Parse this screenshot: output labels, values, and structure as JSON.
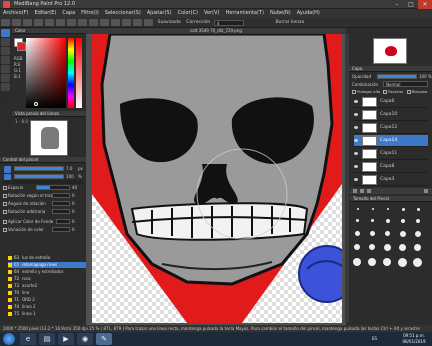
{
  "window": {
    "title": "MediBang Paint Pro 12.0",
    "controls": [
      "–",
      "□",
      "✕"
    ]
  },
  "menu": [
    "Archivo(F)",
    "Editar(E)",
    "Capa",
    "Filtro(I)",
    "Seleccionar(S)",
    "Ajustar(S)",
    "Color(C)",
    "Ver(V)",
    "Herramienta(T)",
    "Nube(N)",
    "Ayuda(H)"
  ],
  "toolbar": {
    "smooth_label": "Suavizado",
    "correction_label": "Corrección",
    "correction_value": "4",
    "clear_label": "Borrar lienzo"
  },
  "document_tab": "calt 3549 70_dld_729.png",
  "color_panel": {
    "title": "Color",
    "rgb_label": "RGB",
    "r": "R:E",
    "g": "G:1",
    "b": "B:1"
  },
  "navigator": {
    "title": "Vista previa del lienzo",
    "zoom": "1 - 8.0"
  },
  "brush_panel": {
    "title": "Control del pincel",
    "size_value": "7.0",
    "size_unit": "px",
    "opacity_value": "100",
    "opacity_unit": "%",
    "options": [
      {
        "label": "Espacio",
        "value": 40
      },
      {
        "label": "Rotación según el trazo",
        "value": 0
      },
      {
        "label": "Ángulo de rotación",
        "value": 0
      },
      {
        "label": "Rotación arbitraria",
        "value": 0
      },
      {
        "label": "Aplicar Color de Fondo",
        "value": 0
      },
      {
        "label": "Variación de color",
        "value": 0
      }
    ]
  },
  "layers_left": [
    {
      "n": "63",
      "name": "luz de estrella",
      "selected": false
    },
    {
      "n": "65",
      "name": "relamapngo.rines",
      "selected": true
    },
    {
      "n": "64",
      "name": "estrella y estrellados",
      "selected": false
    },
    {
      "n": "72",
      "name": "rosa",
      "selected": false
    },
    {
      "n": "73",
      "name": "acorte2",
      "selected": false
    },
    {
      "n": "70",
      "name": "line",
      "selected": false
    },
    {
      "n": "71",
      "name": "ORD 2",
      "selected": false
    },
    {
      "n": "74",
      "name": "linea 2",
      "selected": false
    },
    {
      "n": "75",
      "name": "linea 1",
      "selected": false
    }
  ],
  "right_panel": {
    "layer_title": "Capa",
    "opacity_label": "Opacidad",
    "opacity_value": "100 %",
    "blend_label": "Combinación",
    "blend_value": "Normal",
    "protect_label": "Proteger alfa",
    "clip_label": "Recortar",
    "lock_label": "Bloquear",
    "layers": [
      {
        "name": "Capa6",
        "selected": false
      },
      {
        "name": "Capa10",
        "selected": false
      },
      {
        "name": "Capa12",
        "selected": false
      },
      {
        "name": "Capa14",
        "selected": true
      },
      {
        "name": "Capa11",
        "selected": false
      },
      {
        "name": "Capa8",
        "selected": false
      },
      {
        "name": "Capa3",
        "selected": false
      }
    ],
    "brush_size_title": "Tamaño del Pincel"
  },
  "status": {
    "text": "2000 * 2500 pixel  (13.2 * 16.9cm)  350 dpi  25 %  ( 871, 879 )  Para trazar una línea recta, mantenga pulsada la tecla Mayús. Para cambiar el tamaño del pincel, mantenga pulsada las teclas Ctrl + Alt y arrastre"
  },
  "taskbar": {
    "time": "09:51 p.m.",
    "date": "06/01/2019",
    "lang": "ES"
  }
}
